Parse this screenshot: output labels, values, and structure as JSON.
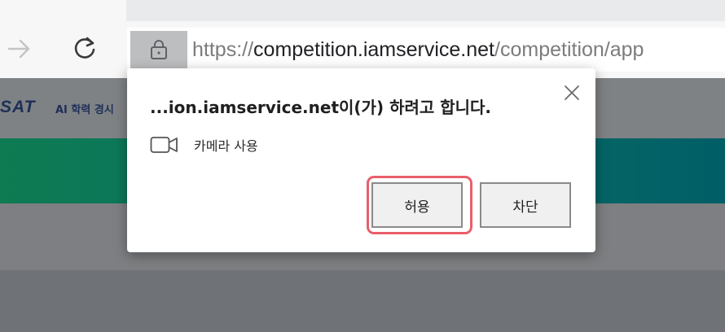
{
  "browser": {
    "url": {
      "scheme": "https://",
      "host": "competition.iamservice.net",
      "path": "/competition/app"
    }
  },
  "site": {
    "logo": "SAT",
    "subtitle": "AI 학력 경시"
  },
  "dialog": {
    "title": "...ion.iamservice.net이(가) 하려고 합니다.",
    "permission_label": "카메라 사용",
    "allow_label": "허용",
    "block_label": "차단"
  }
}
